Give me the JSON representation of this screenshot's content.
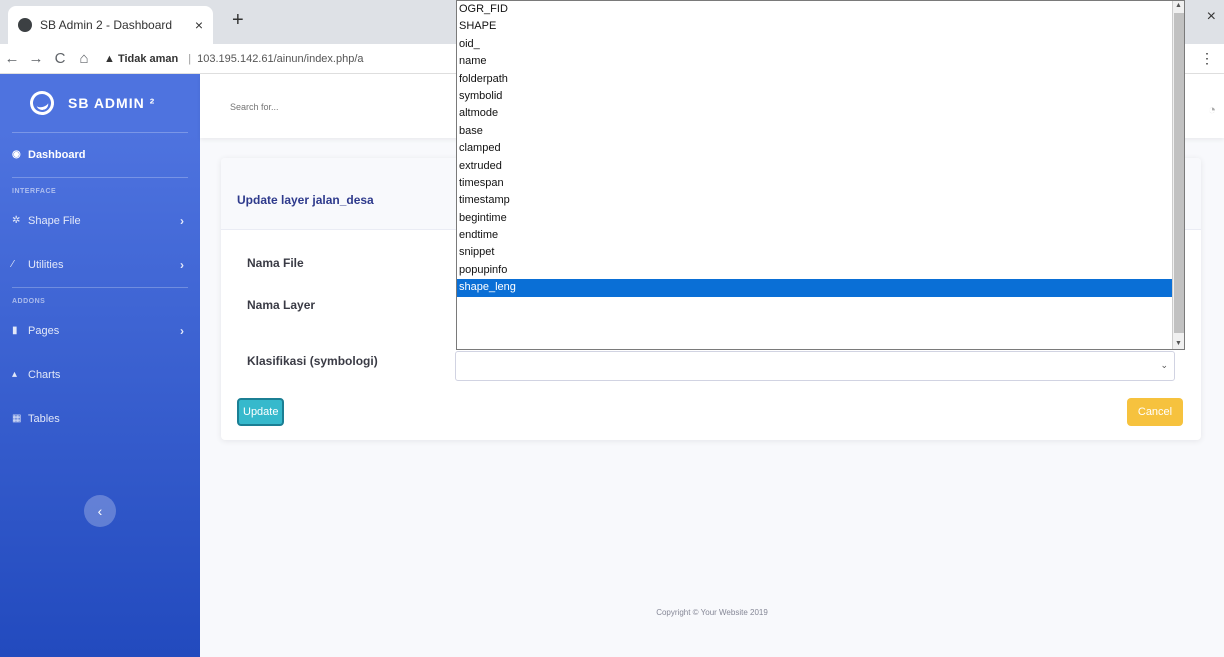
{
  "browser": {
    "tab_title": "SB Admin 2 - Dashboard",
    "tab_close": "×",
    "new_tab": "+",
    "window_close": "×",
    "security_label": "▲ Tidak aman",
    "url": "103.195.142.61/ainun/index.php/a",
    "back": "←",
    "forward": "→",
    "reload": "C",
    "home": "⌂",
    "menu": "⋮"
  },
  "sidebar": {
    "brand": "SB ADMIN ²",
    "items": [
      {
        "label": "Dashboard",
        "icon": "tachometer-icon",
        "glyph": "◉"
      },
      {
        "heading": "INTERFACE"
      },
      {
        "label": "Shape File",
        "icon": "cog-icon",
        "glyph": "✲",
        "chevron": "›"
      },
      {
        "label": "Utilities",
        "icon": "wrench-icon",
        "glyph": "⁄",
        "chevron": "›"
      },
      {
        "heading": "ADDONS"
      },
      {
        "label": "Pages",
        "icon": "folder-icon",
        "glyph": "▮",
        "chevron": "›"
      },
      {
        "label": "Charts",
        "icon": "chart-area-icon",
        "glyph": "▴"
      },
      {
        "label": "Tables",
        "icon": "table-icon",
        "glyph": "▦"
      }
    ],
    "toggle_glyph": "‹"
  },
  "topbar": {
    "search_placeholder": "Search for..."
  },
  "card": {
    "title": "Update layer jalan_desa",
    "labels": {
      "nama_file": "Nama File",
      "nama_layer": "Nama Layer",
      "klasifikasi": "Klasifikasi (symbologi)"
    },
    "update_button": "Update",
    "cancel_button": "Cancel"
  },
  "dropdown": {
    "options": [
      "OGR_FID",
      "SHAPE",
      "oid_",
      "name",
      "folderpath",
      "symbolid",
      "altmode",
      "base",
      "clamped",
      "extruded",
      "timespan",
      "timestamp",
      "begintime",
      "endtime",
      "snippet",
      "popupinfo",
      "shape_leng"
    ],
    "selected": "shape_leng"
  },
  "footer": {
    "copyright": "Copyright © Your Website 2019"
  },
  "colors": {
    "sidebar_top": "#4e73df",
    "sidebar_bottom": "#224abe",
    "update_button": "#36b9cc",
    "cancel_button": "#f6c23e",
    "selected_option": "#0a6fd6"
  }
}
